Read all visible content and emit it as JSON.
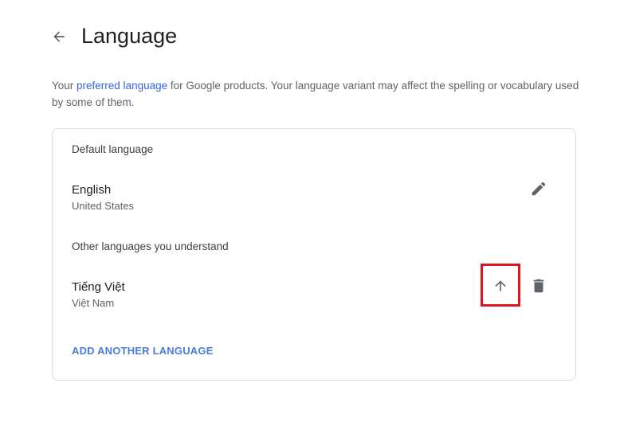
{
  "header": {
    "title": "Language",
    "back_icon": "arrow-back-icon"
  },
  "intro": {
    "prefix": "Your ",
    "link_text": "preferred language",
    "suffix": " for Google products. Your language variant may affect the spelling or vocabulary used by some of them."
  },
  "default_section": {
    "heading": "Default language",
    "language": {
      "name": "English",
      "region": "United States",
      "edit_icon": "pencil-icon"
    }
  },
  "other_section": {
    "heading": "Other languages you understand",
    "languages": [
      {
        "name": "Tiếng Việt",
        "region": "Việt Nam",
        "move_up_icon": "arrow-up-icon",
        "delete_icon": "trash-icon"
      }
    ]
  },
  "add_language_label": "ADD ANOTHER LANGUAGE",
  "colors": {
    "link": "#3367d6",
    "highlight": "#e0141e",
    "icon": "#5f6368"
  }
}
